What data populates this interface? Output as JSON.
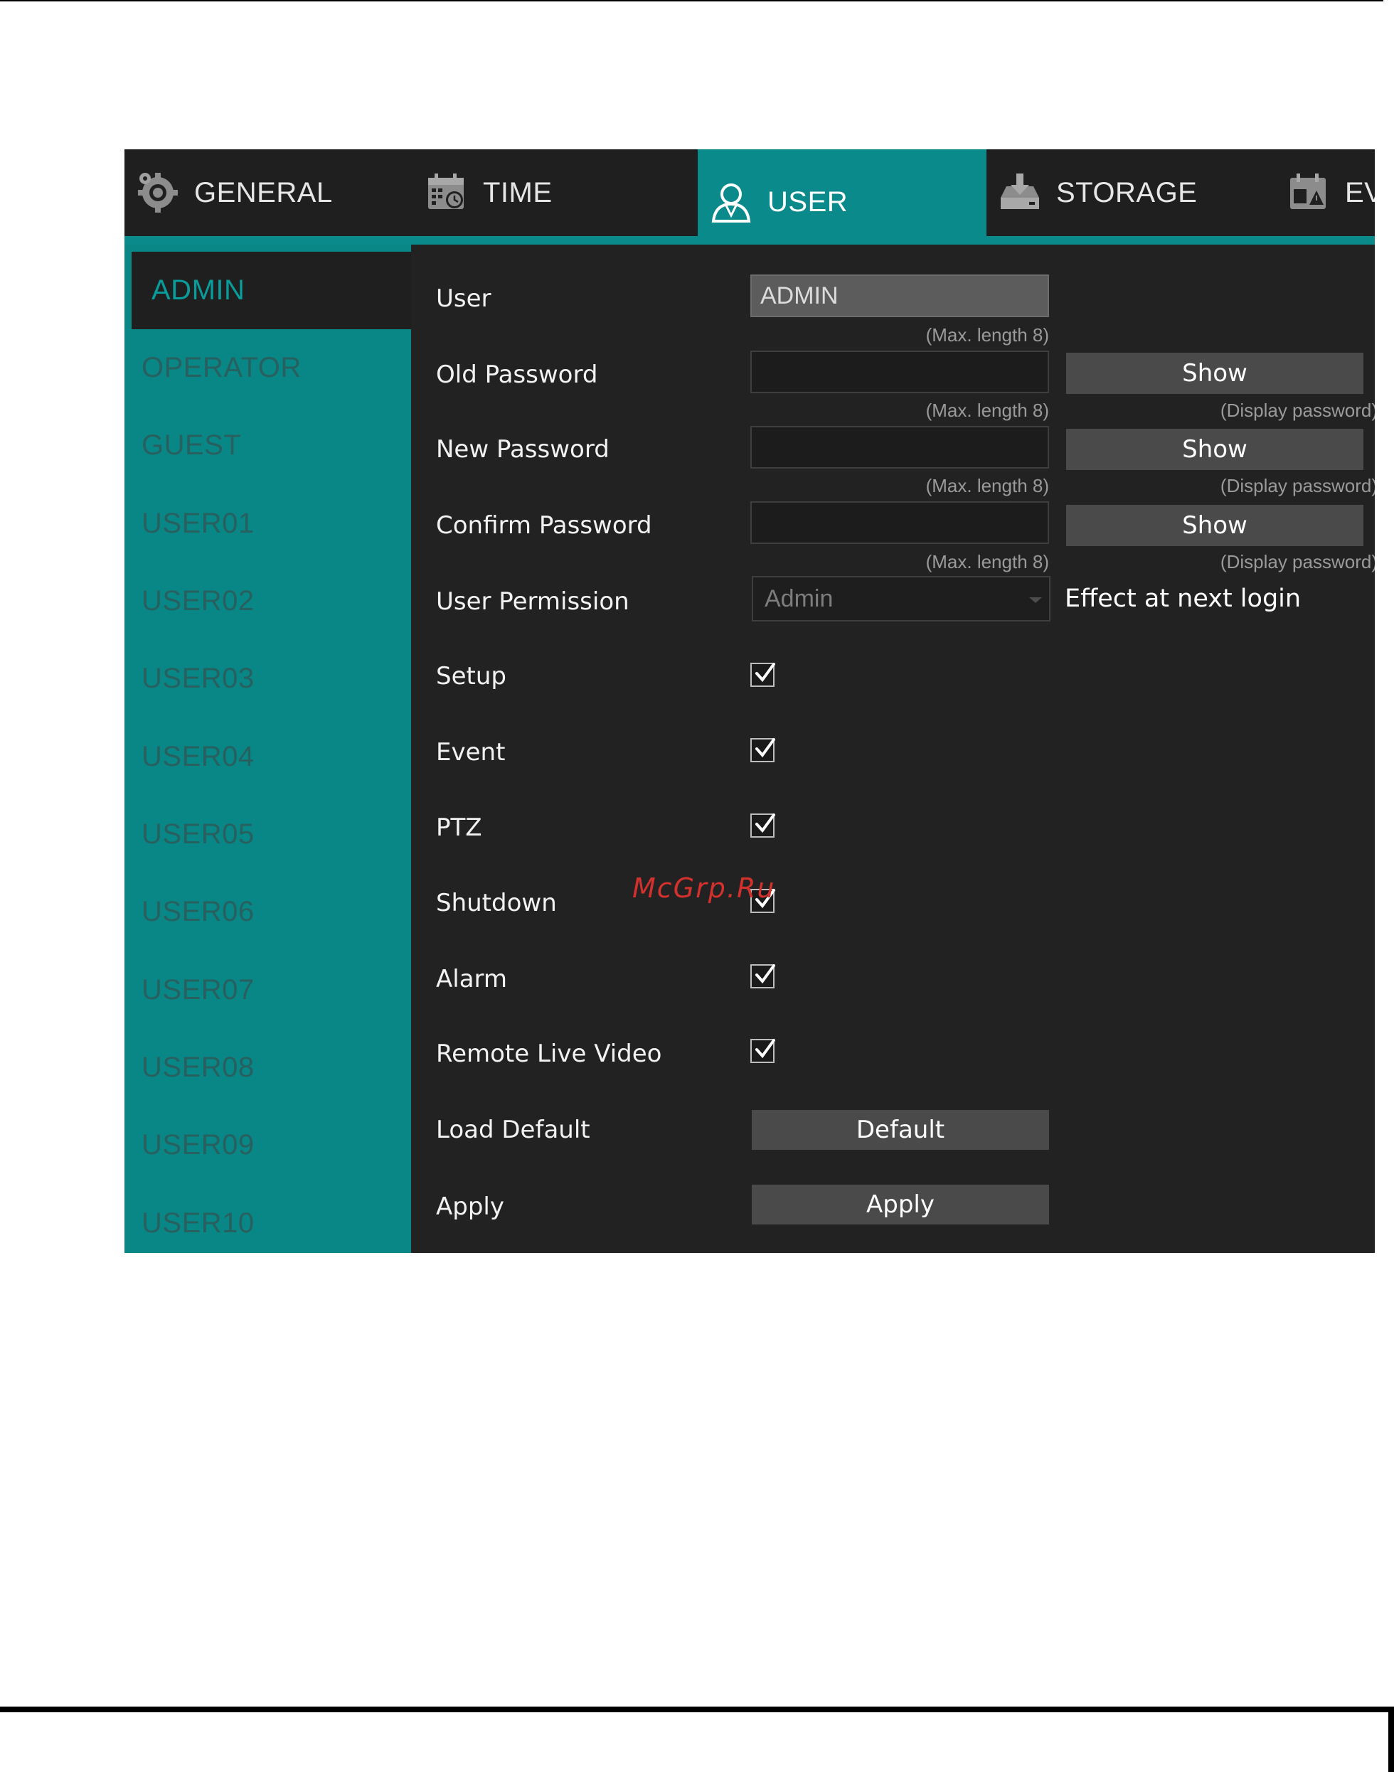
{
  "tabs": [
    {
      "label": "GENERAL",
      "icon": "gear-icon"
    },
    {
      "label": "TIME",
      "icon": "calendar-clock-icon"
    },
    {
      "label": "USER",
      "icon": "user-icon",
      "active": true
    },
    {
      "label": "STORAGE",
      "icon": "storage-icon"
    },
    {
      "label": "EV",
      "icon": "event-icon"
    }
  ],
  "users": [
    "ADMIN",
    "OPERATOR",
    "GUEST",
    "USER01",
    "USER02",
    "USER03",
    "USER04",
    "USER05",
    "USER06",
    "USER07",
    "USER08",
    "USER09",
    "USER10"
  ],
  "selected_user": "ADMIN",
  "form": {
    "user_label": "User",
    "user_value": "ADMIN",
    "old_password_label": "Old Password",
    "new_password_label": "New Password",
    "confirm_password_label": "Confirm Password",
    "max_length_hint": "(Max. length 8)",
    "show_label": "Show",
    "display_password_hint": "(Display password)",
    "permission_label": "User Permission",
    "permission_value": "Admin",
    "effect_note": "Effect at next login",
    "permissions": [
      {
        "label": "Setup",
        "checked": true
      },
      {
        "label": "Event",
        "checked": true
      },
      {
        "label": "PTZ",
        "checked": true
      },
      {
        "label": "Shutdown",
        "checked": true
      },
      {
        "label": "Alarm",
        "checked": true
      },
      {
        "label": "Remote Live Video",
        "checked": true
      }
    ],
    "load_default_label": "Load Default",
    "default_button": "Default",
    "apply_label": "Apply",
    "apply_button": "Apply"
  },
  "watermark": "McGrp.Ru",
  "colors": {
    "accent": "#0a8a8a",
    "panel": "#222222",
    "list_text": "#27605f"
  }
}
